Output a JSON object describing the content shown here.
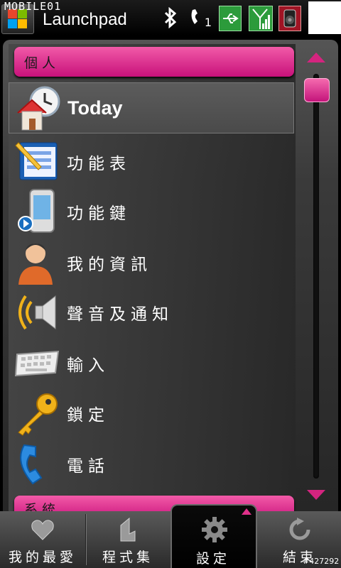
{
  "status_bar": {
    "app_title": "Launchpad",
    "watermark": "MOBILE01",
    "call_count": "1"
  },
  "sections": [
    {
      "title": "個人"
    },
    {
      "title": "系統"
    }
  ],
  "items": [
    {
      "label": "Today",
      "icon": "today-clock-house-icon",
      "selected": true
    },
    {
      "label": "功能表",
      "icon": "menu-icon"
    },
    {
      "label": "功能鍵",
      "icon": "buttons-icon"
    },
    {
      "label": "我的資訊",
      "icon": "owner-info-icon"
    },
    {
      "label": "聲音及通知",
      "icon": "sounds-icon"
    },
    {
      "label": "輸入",
      "icon": "keyboard-icon"
    },
    {
      "label": "鎖定",
      "icon": "key-icon"
    },
    {
      "label": "電話",
      "icon": "phone-icon"
    }
  ],
  "tabs": [
    {
      "label": "我的最愛",
      "icon": "heart-icon"
    },
    {
      "label": "程式集",
      "icon": "programs-icon"
    },
    {
      "label": "設定",
      "icon": "gear-icon",
      "active": true
    },
    {
      "label": "結束",
      "icon": "exit-icon"
    }
  ],
  "image_id": "#427292",
  "colors": {
    "accent": "#d4247f"
  }
}
